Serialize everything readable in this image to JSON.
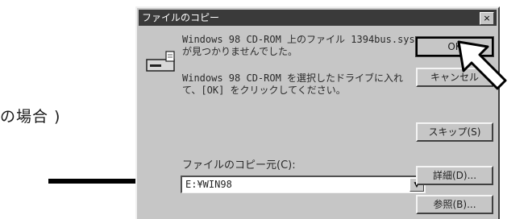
{
  "caption": "の場合 )",
  "dialog": {
    "title": "ファイルのコピー",
    "close_label": "×",
    "message1": "Windows 98 CD-ROM 上のファイル 1394bus.sys が見つかりませんでした。",
    "message2": "Windows 98 CD-ROM を選択したドライブに入れて、[OK] をクリックしてください。",
    "copy_from_label": "ファイルのコピー元(C):",
    "copy_from_value": "E:¥WIN98",
    "dropdown_glyph": "▼",
    "buttons": {
      "ok": "OK",
      "cancel": "キャンセル",
      "skip": "スキップ(S)",
      "details": "詳細(D)...",
      "browse": "参照(B)..."
    }
  },
  "icons": {
    "drive": "drive-icon",
    "pointer_arrow": "arrow-right-icon",
    "mouse_cursor": "cursor-arrow-icon"
  },
  "colors": {
    "dialog_face": "#c6c6c6",
    "titlebar": "#3a3a3a"
  }
}
